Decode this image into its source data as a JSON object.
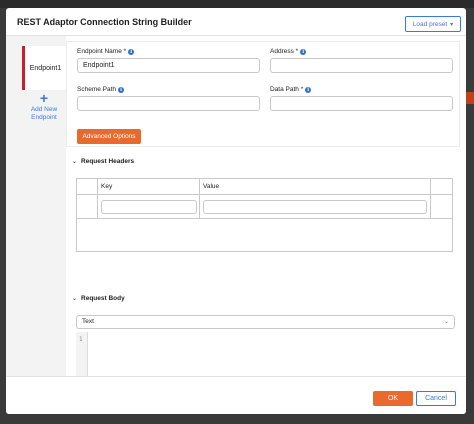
{
  "modal": {
    "title": "REST Adaptor Connection String Builder",
    "load_preset_label": "Load preset",
    "load_preset_icon": "chevron-down-icon"
  },
  "sidebar": {
    "endpoint_tab_label": "Endpoint1",
    "add_endpoint_label_line1": "Add New",
    "add_endpoint_label_line2": "Endpoint",
    "add_icon": "plus-icon",
    "active_color": "#c8202c"
  },
  "form": {
    "endpoint_name_label": "Endpoint Name *",
    "endpoint_name_value": "Endpoint1",
    "address_label": "Address *",
    "address_value": "",
    "scheme_path_label": "Scheme Path",
    "scheme_path_value": "",
    "data_path_label": "Data Path *",
    "data_path_value": "",
    "advanced_options_label": "Advanced Options",
    "info_icon": "info-icon"
  },
  "request_headers": {
    "section_label": "Request Headers",
    "columns": [
      "Key",
      "Value"
    ],
    "rows": [
      {
        "key": "",
        "value": ""
      }
    ]
  },
  "request_body": {
    "section_label": "Request Body",
    "content_type": "Text",
    "line_numbers": [
      "1"
    ]
  },
  "footer": {
    "ok_label": "OK",
    "cancel_label": "Cancel"
  },
  "colors": {
    "accent_orange": "#e86a2c",
    "link_blue": "#3a7bd5"
  }
}
